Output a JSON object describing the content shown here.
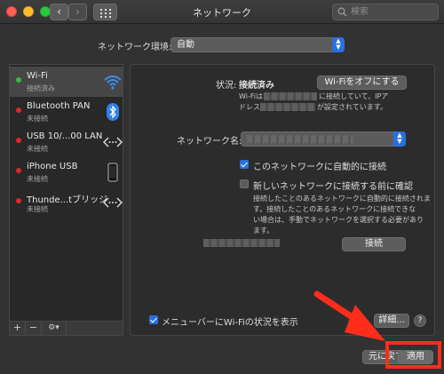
{
  "window": {
    "title": "ネットワーク"
  },
  "search": {
    "placeholder": "検索"
  },
  "location": {
    "label": "ネットワーク環境:",
    "value": "自動"
  },
  "services": [
    {
      "name": "Wi-Fi",
      "status": "接続済み",
      "dot": "#2fbf3c",
      "icon": "wifi-icon"
    },
    {
      "name": "Bluetooth PAN",
      "status": "未接続",
      "dot": "#e0262a",
      "icon": "bluetooth-icon"
    },
    {
      "name": "USB 10/...00 LAN",
      "status": "未接続",
      "dot": "#e0262a",
      "icon": "ethernet-icon"
    },
    {
      "name": "iPhone USB",
      "status": "未接続",
      "dot": "#e0262a",
      "icon": "iphone-icon"
    },
    {
      "name": "Thunde...tブリッジ",
      "status": "未接続",
      "dot": "#e0262a",
      "icon": "thunderbolt-bridge-icon"
    }
  ],
  "sidebar_toolbar": {
    "add": "+",
    "remove": "−",
    "action": "⚙▾"
  },
  "status": {
    "label": "状況:",
    "value": "接続済み",
    "toggle_button": "Wi-Fiをオフにする",
    "desc_line1a": "Wi-Fiは",
    "desc_line1b": "に接続していて、IPア",
    "desc_line2a": "ドレス",
    "desc_line2b": "が設定されています。"
  },
  "network_name": {
    "label": "ネットワーク名:"
  },
  "options": {
    "auto_join": "このネットワークに自動的に接続",
    "ask_join": "新しいネットワークに接続する前に確認",
    "ask_desc_1": "接続したことのあるネットワークに自動的に接続されま",
    "ask_desc_2": "す。接続したことのあるネットワークに接続できな",
    "ask_desc_3": "い場合は、手動でネットワークを選択する必要があり",
    "ask_desc_4": "ます。"
  },
  "connect_button": "接続",
  "menubar_option": "メニューバーにWi-Fiの状況を表示",
  "advanced_button": "詳細...",
  "help": "?",
  "revert_button": "元に戻す",
  "apply_button": "適用",
  "colors": {
    "accent": "#2a6fe0",
    "highlight": "#ff2d1b"
  }
}
